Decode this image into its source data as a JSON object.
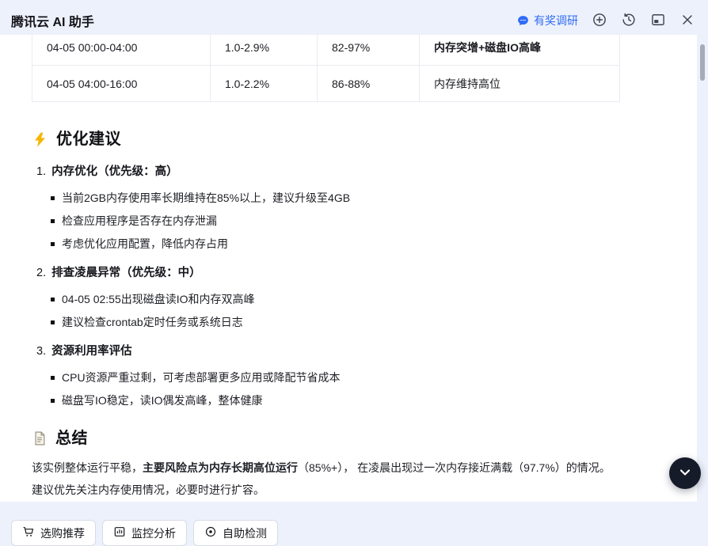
{
  "header": {
    "title": "腾讯云 AI 助手",
    "survey_label": "有奖调研",
    "icons": {
      "survey": "chat-bubble",
      "new_chat": "plus-circle",
      "history": "history-clock",
      "panel": "window-panel",
      "close": "close-x"
    }
  },
  "colors": {
    "accent": "#2e6bf6",
    "fab_bg": "#161b2a",
    "background": "#edf1fb"
  },
  "table": {
    "rows": [
      {
        "time": "04-05 00:00-04:00",
        "cpu": "1.0-2.9%",
        "mem": "82-97%",
        "note": "内存突增+磁盘IO高峰"
      },
      {
        "time": "04-05 04:00-16:00",
        "cpu": "1.0-2.2%",
        "mem": "86-88%",
        "note": "内存维持高位"
      }
    ]
  },
  "sections": {
    "optimization": {
      "icon": "lightning",
      "title": "优化建议",
      "items": [
        {
          "num": "1.",
          "title": "内存优化（优先级：高）",
          "bullets": [
            "当前2GB内存使用率长期维持在85%以上，建议升级至4GB",
            "检查应用程序是否存在内存泄漏",
            "考虑优化应用配置，降低内存占用"
          ]
        },
        {
          "num": "2.",
          "title": "排查凌晨异常（优先级：中）",
          "bullets": [
            "04-05 02:55出现磁盘读IO和内存双高峰",
            "建议检查crontab定时任务或系统日志"
          ]
        },
        {
          "num": "3.",
          "title": "资源利用率评估",
          "bullets": [
            "CPU资源严重过剩，可考虑部署更多应用或降配节省成本",
            "磁盘写IO稳定，读IO偶发高峰，整体健康"
          ]
        }
      ]
    },
    "summary": {
      "icon": "document",
      "title": "总结",
      "segments": [
        {
          "text": "该实例整体运行平稳，",
          "bold": false
        },
        {
          "text": "主要风险点为内存长期高位运行",
          "bold": true
        },
        {
          "text": "（85%+）， 在凌晨出现过一次内存接近满载（97.7%）的情况。建议优先关注内存使用情况，必要时进行扩容。",
          "bold": false
        }
      ]
    }
  },
  "footer": {
    "actions": [
      {
        "label": "选购推荐",
        "icon": "cart"
      },
      {
        "label": "监控分析",
        "icon": "monitor"
      },
      {
        "label": "自助检测",
        "icon": "detect"
      }
    ]
  }
}
